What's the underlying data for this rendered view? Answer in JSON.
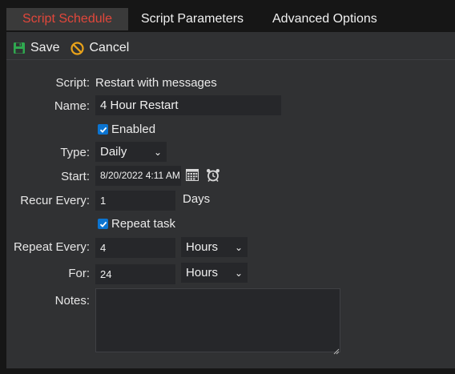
{
  "tabs": [
    "Script Schedule",
    "Script Parameters",
    "Advanced Options"
  ],
  "toolbar": {
    "save": "Save",
    "cancel": "Cancel"
  },
  "form": {
    "script_label": "Script:",
    "script_value": "Restart with messages",
    "name_label": "Name:",
    "name_value": "4 Hour Restart",
    "enabled_label": "Enabled",
    "type_label": "Type:",
    "type_value": "Daily",
    "start_label": "Start:",
    "start_value": "8/20/2022 4:11 AM",
    "recur_label": "Recur Every:",
    "recur_value": "1",
    "recur_unit": "Days",
    "repeat_task_label": "Repeat task",
    "repeat_every_label": "Repeat Every:",
    "repeat_every_value": "4",
    "repeat_every_unit": "Hours",
    "for_label": "For:",
    "for_value": "24",
    "for_unit": "Hours",
    "notes_label": "Notes:",
    "notes_value": ""
  },
  "colors": {
    "accent_red": "#e2473b",
    "save_green": "#2fa84f",
    "cancel_orange": "#e8a21a",
    "checkbox_blue": "#0b74d1"
  }
}
